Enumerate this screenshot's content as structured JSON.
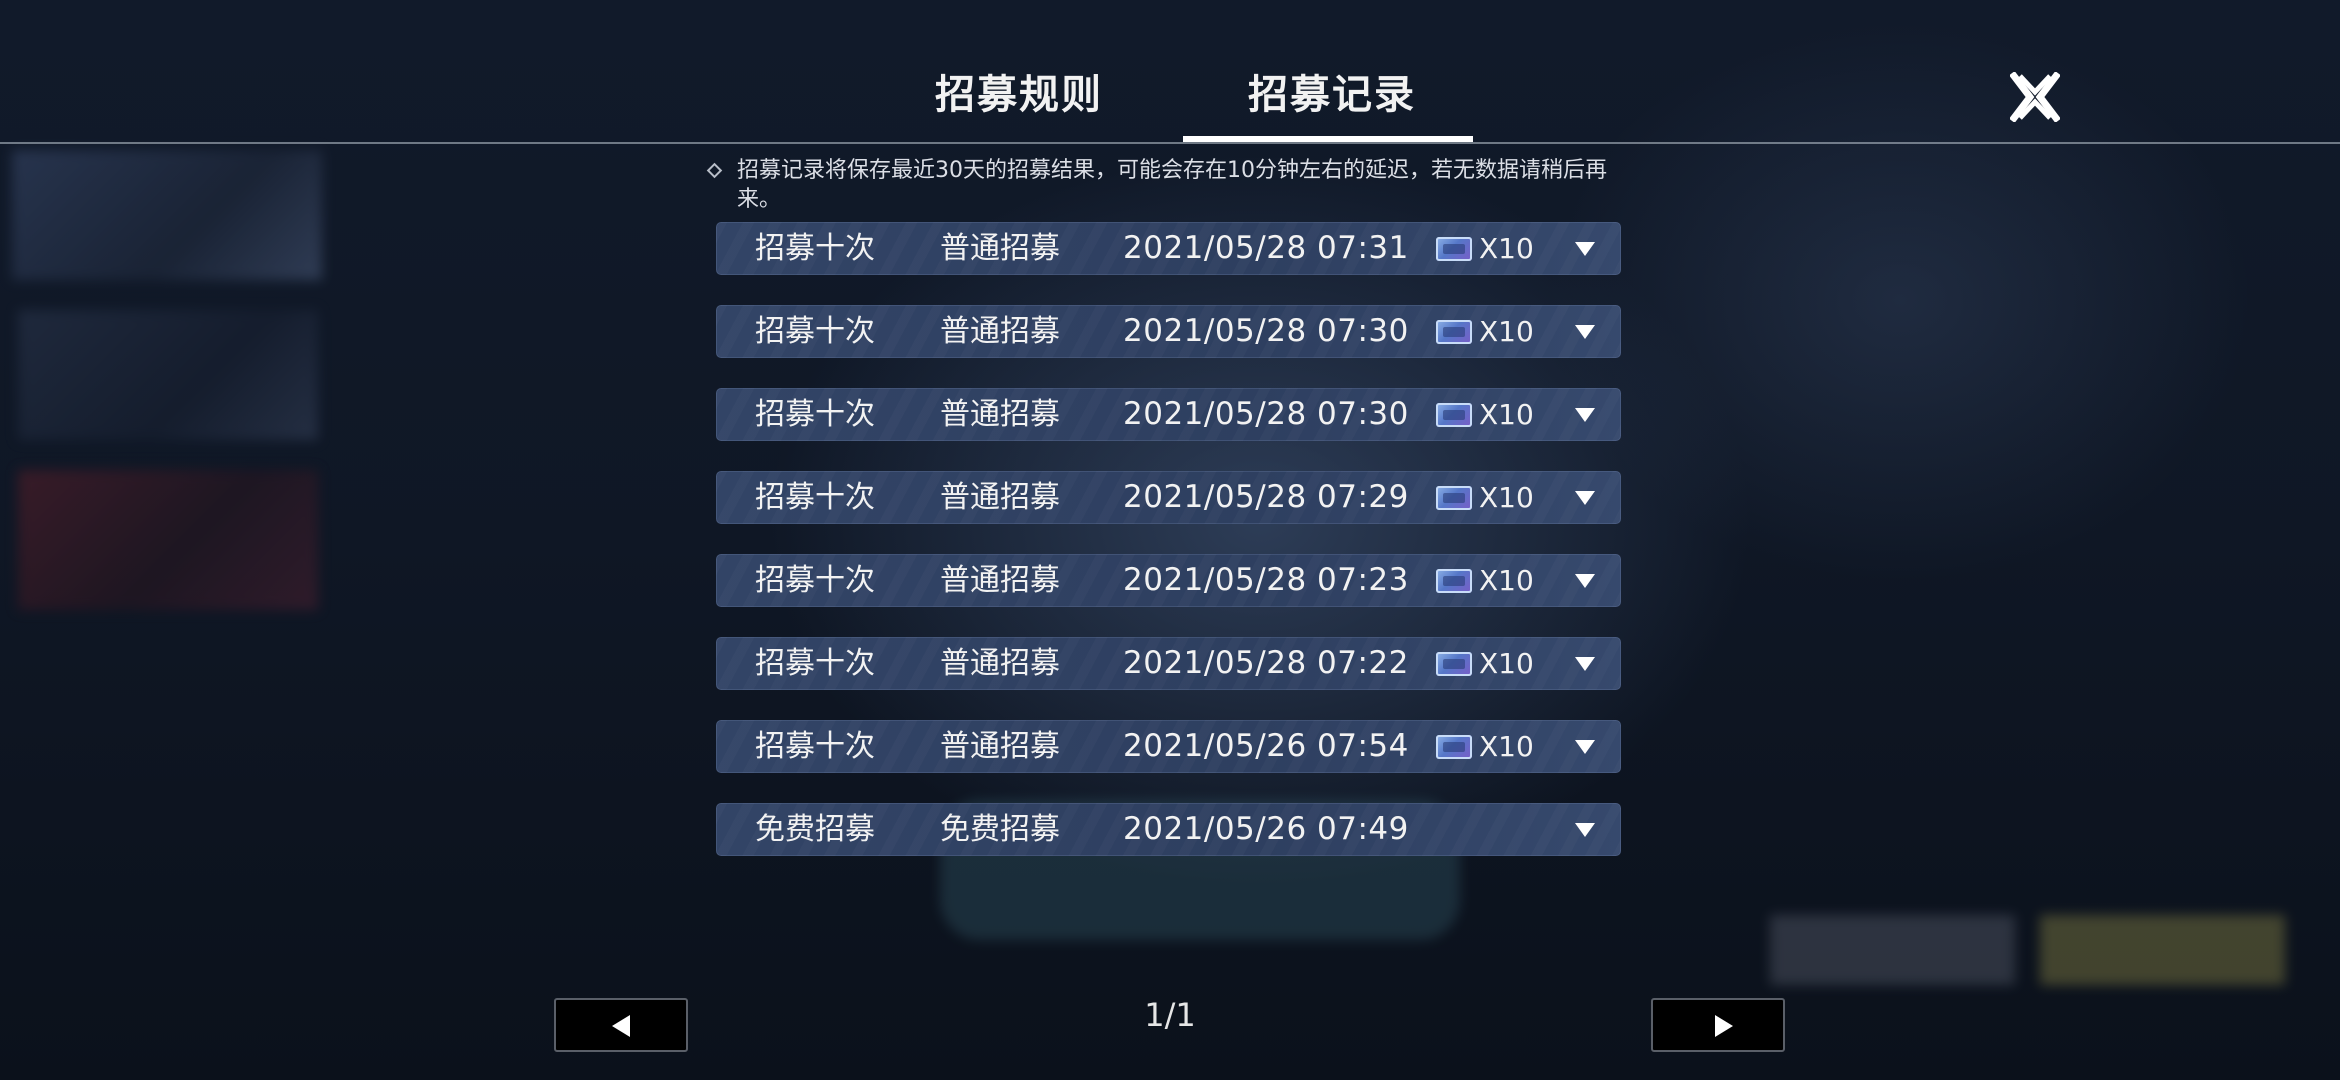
{
  "tabs": {
    "rules_label": "招募规则",
    "records_label": "招募记录",
    "active": "records"
  },
  "notice": {
    "text": "招募记录将保存最近30天的招募结果，可能会存在10分钟左右的延迟，若无数据请稍后再来。"
  },
  "records": [
    {
      "type": "招募十次",
      "pool": "普通招募",
      "time": "2021/05/28 07:31",
      "cost": "X10",
      "has_ticket": true
    },
    {
      "type": "招募十次",
      "pool": "普通招募",
      "time": "2021/05/28 07:30",
      "cost": "X10",
      "has_ticket": true
    },
    {
      "type": "招募十次",
      "pool": "普通招募",
      "time": "2021/05/28 07:30",
      "cost": "X10",
      "has_ticket": true
    },
    {
      "type": "招募十次",
      "pool": "普通招募",
      "time": "2021/05/28 07:29",
      "cost": "X10",
      "has_ticket": true
    },
    {
      "type": "招募十次",
      "pool": "普通招募",
      "time": "2021/05/28 07:23",
      "cost": "X10",
      "has_ticket": true
    },
    {
      "type": "招募十次",
      "pool": "普通招募",
      "time": "2021/05/28 07:22",
      "cost": "X10",
      "has_ticket": true
    },
    {
      "type": "招募十次",
      "pool": "普通招募",
      "time": "2021/05/26 07:54",
      "cost": "X10",
      "has_ticket": true
    },
    {
      "type": "免费招募",
      "pool": "免费招募",
      "time": "2021/05/26 07:49",
      "cost": "",
      "has_ticket": false
    }
  ],
  "pager": {
    "page": "1/1"
  },
  "icons": {
    "close": "close-x-icon",
    "ticket": "recruit-ticket-icon",
    "expand": "caret-down-icon",
    "prev": "triangle-left-icon",
    "next": "triangle-right-icon"
  },
  "colors": {
    "row_bg": "#324466",
    "text": "#f2f2f2",
    "background": "#0d131f"
  }
}
